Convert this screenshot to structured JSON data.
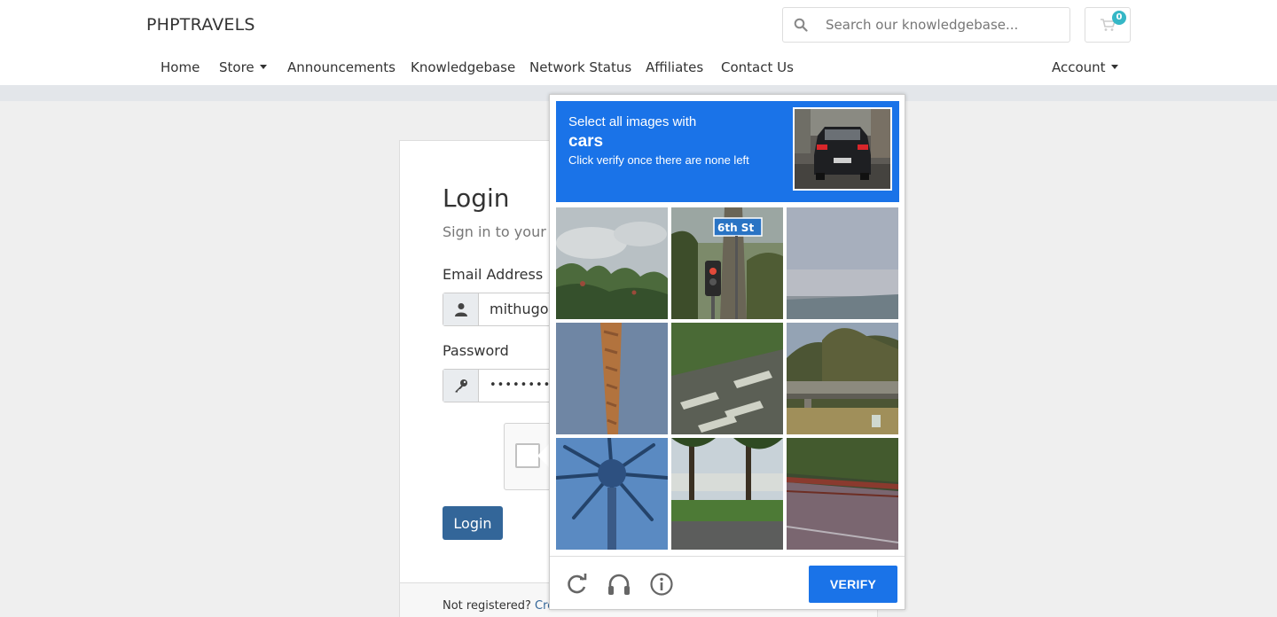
{
  "header": {
    "brand": "PHPTRAVELS",
    "search_placeholder": "Search our knowledgebase...",
    "cart_count": "0"
  },
  "nav": {
    "items": [
      {
        "label": "Home"
      },
      {
        "label": "Store"
      },
      {
        "label": "Announcements"
      },
      {
        "label": "Knowledgebase"
      },
      {
        "label": "Network Status"
      },
      {
        "label": "Affiliates"
      },
      {
        "label": "Contact Us"
      }
    ],
    "account_label": "Account"
  },
  "login": {
    "title": "Login",
    "subtitle": "Sign in to your a",
    "email_label": "Email Address",
    "email_value": "mithugop",
    "password_label": "Password",
    "password_value": "••••••••••••",
    "button_label": "Login",
    "not_registered": "Not registered?",
    "create_link": "Crea"
  },
  "captcha": {
    "select_text": "Select all images with",
    "object": "cars",
    "instruction": "Click verify once there are none left",
    "verify_label": "VERIFY",
    "tiles": [
      "trees and sky",
      "6th St sign and traffic light",
      "sky",
      "palm trunk",
      "road crosswalk",
      "overpass and hills",
      "palm tree",
      "trees and road",
      "road with guardrail"
    ],
    "street_sign_text": "6th St"
  },
  "colors": {
    "accent_blue": "#1a73e8",
    "login_button": "#336699",
    "badge": "#35b7c6"
  },
  "icons": [
    "search-icon",
    "cart-icon",
    "user-icon",
    "key-icon",
    "reload-icon",
    "headphones-icon",
    "info-icon"
  ]
}
